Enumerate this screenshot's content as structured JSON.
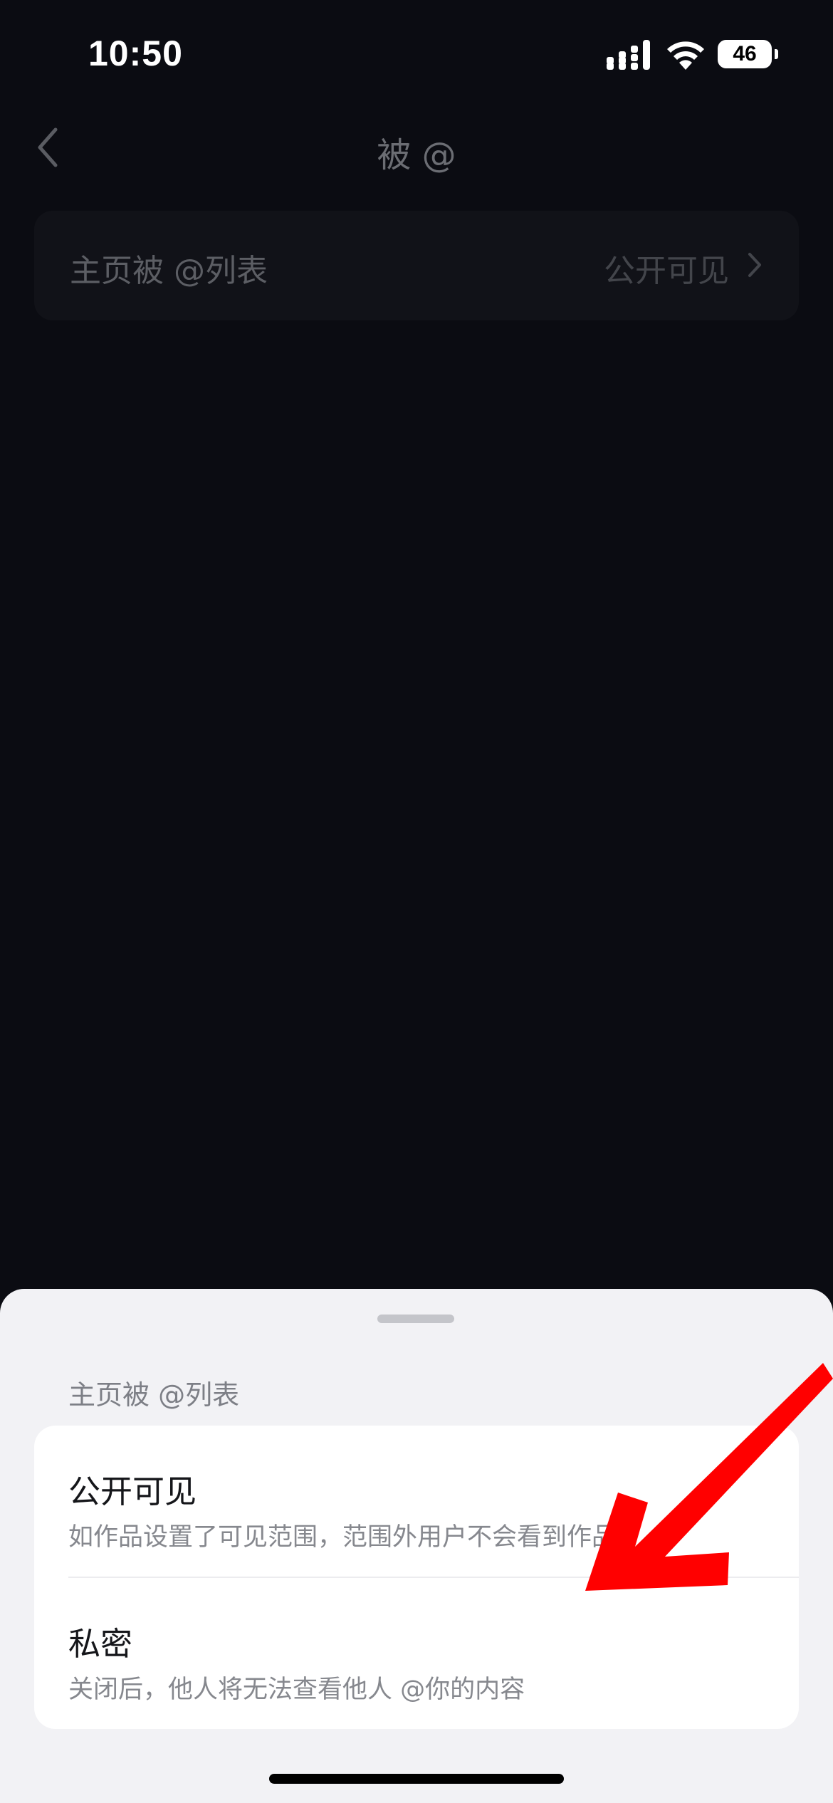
{
  "status_bar": {
    "time": "10:50",
    "battery": "46",
    "icons": [
      "signal-icon",
      "wifi-icon",
      "battery-icon"
    ]
  },
  "nav": {
    "title": "被 @",
    "back_icon": "chevron-left-icon"
  },
  "setting": {
    "label": "主页被 @列表",
    "value": "公开可见",
    "icon": "chevron-right-icon"
  },
  "sheet": {
    "title": "主页被 @列表",
    "options": [
      {
        "title": "公开可见",
        "description": "如作品设置了可见范围，范围外用户不会看到作品"
      },
      {
        "title": "私密",
        "description": "关闭后，他人将无法查看他人 @你的内容"
      }
    ]
  },
  "colors": {
    "background": "#0b0c12",
    "sheet_background": "#f2f2f5",
    "card_background": "#ffffff",
    "annotation_arrow": "#ff0000"
  }
}
